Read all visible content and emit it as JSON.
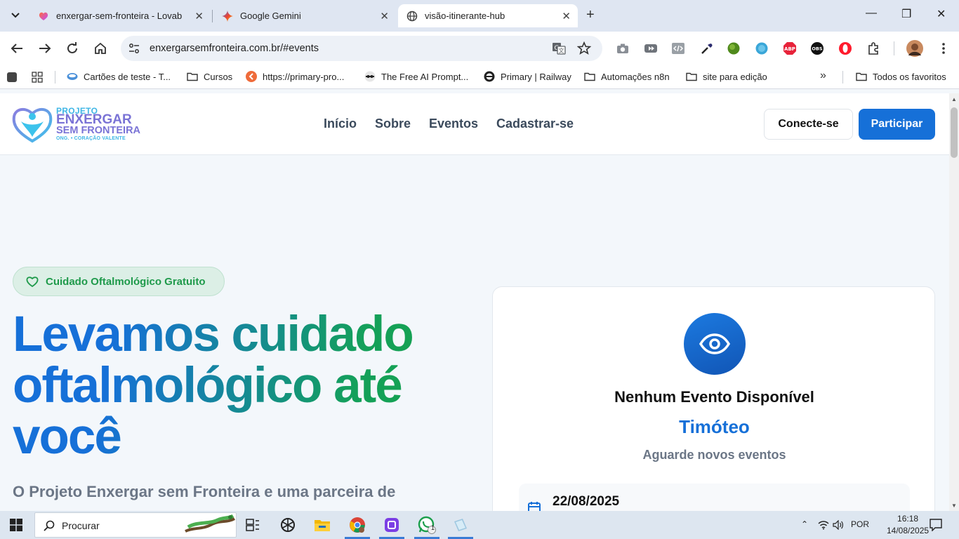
{
  "browser": {
    "tabs": [
      {
        "title": "enxergar-sem-fronteira - Lovab",
        "active": false
      },
      {
        "title": "Google Gemini",
        "active": false
      },
      {
        "title": "visão-itinerante-hub",
        "active": true
      }
    ],
    "url": "enxergarsemfronteira.com.br/#events",
    "bookmarks": [
      {
        "label": "Cartões de teste - T...",
        "icon": "globe-icon"
      },
      {
        "label": "Cursos",
        "icon": "folder-icon"
      },
      {
        "label": "https://primary-pro...",
        "icon": "n8n-icon"
      },
      {
        "label": "The Free AI Prompt...",
        "icon": "avatar-icon"
      },
      {
        "label": "Primary | Railway",
        "icon": "railway-icon"
      },
      {
        "label": "Automações n8n",
        "icon": "folder-icon"
      },
      {
        "label": "site para edição",
        "icon": "folder-icon"
      }
    ],
    "all_bookmarks": "Todos os favoritos"
  },
  "site": {
    "logo": {
      "line1": "PROJETO",
      "line2": "ENXERGAR",
      "line3": "SEM FRONTEIRA",
      "line4": "ONG. • CORAÇÃO VALENTE"
    },
    "nav": [
      "Início",
      "Sobre",
      "Eventos",
      "Cadastrar-se"
    ],
    "connect_label": "Conecte-se",
    "join_label": "Participar",
    "badge": "Cuidado Oftalmológico Gratuito",
    "hero_title": "Levamos cuidado oftalmológico até você",
    "hero_sub": "O Projeto Enxergar sem Fronteira e uma parceira de",
    "event_card": {
      "title": "Nenhum Evento Disponível",
      "name": "Timóteo",
      "wait": "Aguarde novos eventos",
      "date": "22/08/2025"
    }
  },
  "taskbar": {
    "search_label": "Procurar",
    "language": "POR",
    "time": "16:18",
    "date": "14/08/2025",
    "whatsapp_badge": "1"
  },
  "colors": {
    "brand_blue": "#1670d8",
    "brand_green": "#16a34a",
    "badge_bg": "#dcefe6"
  }
}
